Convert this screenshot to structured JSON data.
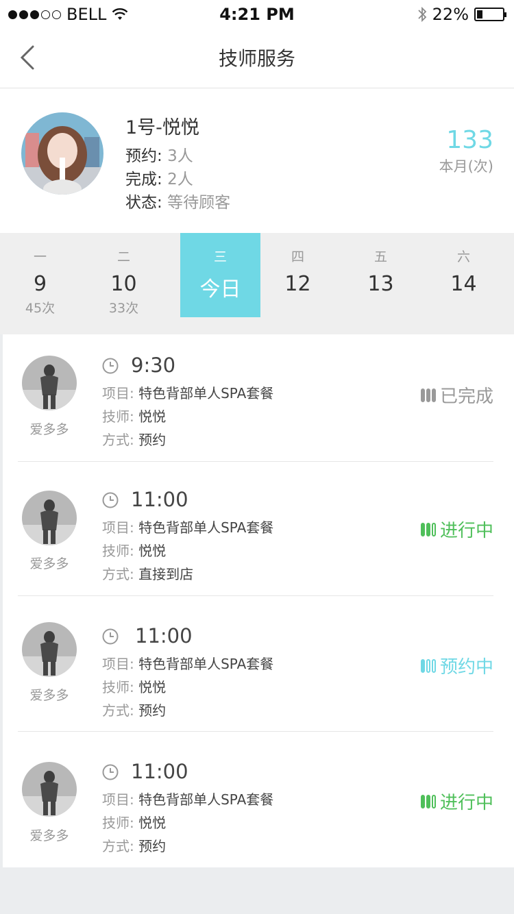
{
  "status_bar": {
    "carrier": "BELL",
    "time": "4:21 PM",
    "battery": "22%"
  },
  "nav": {
    "title": "技师服务"
  },
  "profile": {
    "name": "1号-悦悦",
    "appointment_label": "预约:",
    "appointment_value": "3人",
    "completed_label": "完成:",
    "completed_value": "2人",
    "state_label": "状态:",
    "state_value": "等待顾客",
    "monthly_count": "133",
    "monthly_label": "本月(次)"
  },
  "week": [
    {
      "weekday": "一",
      "date": "9",
      "count": "45次"
    },
    {
      "weekday": "二",
      "date": "10",
      "count": "33次"
    },
    {
      "weekday": "三",
      "date": "今日",
      "count": ""
    },
    {
      "weekday": "四",
      "date": "12",
      "count": ""
    },
    {
      "weekday": "五",
      "date": "13",
      "count": ""
    },
    {
      "weekday": "六",
      "date": "14",
      "count": ""
    }
  ],
  "labels": {
    "project": "项目:",
    "tech": "技师:",
    "mode": "方式:"
  },
  "appointments": [
    {
      "user": "爱多多",
      "time": "9:30",
      "project": "特色背部单人SPA套餐",
      "tech": "悦悦",
      "mode": "预约",
      "status": "已完成",
      "status_color": "#999999"
    },
    {
      "user": "爱多多",
      "time": "11:00",
      "project": "特色背部单人SPA套餐",
      "tech": "悦悦",
      "mode": "直接到店",
      "status": "进行中",
      "status_color": "#4fbf5a"
    },
    {
      "user": "爱多多",
      "time": "11:00",
      "project": "特色背部单人SPA套餐",
      "tech": "悦悦",
      "mode": "预约",
      "status": "预约中",
      "status_color": "#6fd8e5"
    },
    {
      "user": "爱多多",
      "time": "11:00",
      "project": "特色背部单人SPA套餐",
      "tech": "悦悦",
      "mode": "预约",
      "status": "进行中",
      "status_color": "#4fbf5a"
    }
  ],
  "colors": {
    "accent": "#6fd8e5",
    "in_progress": "#4fbf5a",
    "done": "#999999"
  }
}
